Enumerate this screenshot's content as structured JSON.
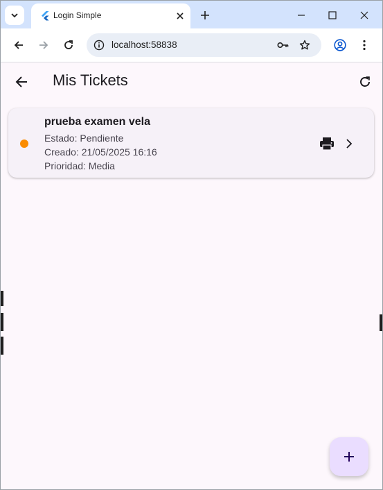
{
  "browser": {
    "tab_title": "Login Simple",
    "url": "localhost:58838"
  },
  "icons": {
    "tab_search": "chevron-down-icon",
    "favicon": "flutter-icon",
    "tab_close": "close-icon",
    "new_tab": "plus-icon",
    "minimize": "minimize-icon",
    "maximize": "maximize-icon",
    "close_window": "close-icon",
    "back": "arrow-left-icon",
    "forward": "arrow-right-icon",
    "reload": "refresh-icon",
    "site_info": "site-info-icon",
    "password_key": "key-icon",
    "bookmark": "star-icon",
    "profile": "account-icon",
    "menu": "more-vert-icon",
    "print": "printer-icon",
    "chevron": "chevron-right-icon",
    "fab": "plus-icon"
  },
  "app": {
    "title": "Mis Tickets"
  },
  "tickets": [
    {
      "title": "prueba examen vela",
      "estado": "Estado: Pendiente",
      "creado": "Creado: 21/05/2025 16:16",
      "prioridad": "Prioridad: Media",
      "status_color": "#fb8c00"
    }
  ],
  "colors": {
    "tabstrip": "#d3e3fd",
    "background": "#fdf7fc",
    "card": "#f6f1f8",
    "fab": "#eaddff",
    "status_pending": "#fb8c00"
  }
}
